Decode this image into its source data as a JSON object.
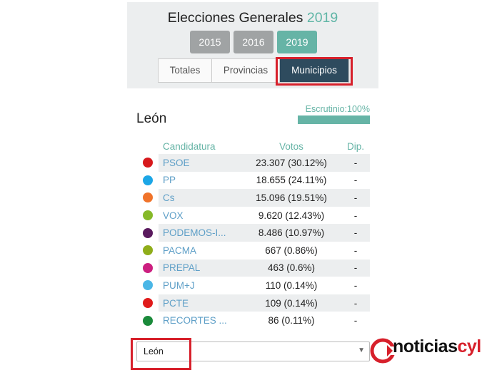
{
  "header": {
    "title_prefix": "Elecciones Generales",
    "title_year": "2019",
    "years": [
      {
        "label": "2015",
        "active": false
      },
      {
        "label": "2016",
        "active": false
      },
      {
        "label": "2019",
        "active": true
      }
    ],
    "tabs": [
      {
        "label": "Totales",
        "active": false
      },
      {
        "label": "Provincias",
        "active": false
      },
      {
        "label": "Municipios",
        "active": true
      }
    ]
  },
  "region": {
    "name": "León",
    "scrutiny_label": "Escrutinio:100%",
    "scrutiny_progress": 1.0
  },
  "table": {
    "headers": {
      "candidatura": "Candidatura",
      "votos": "Votos",
      "dip": "Dip."
    },
    "rows": [
      {
        "party": "PSOE",
        "votes": "23.307 (30.12%)",
        "dip": "-",
        "color": "#d7191c"
      },
      {
        "party": "PP",
        "votes": "18.655 (24.11%)",
        "dip": "-",
        "color": "#1ca6e6"
      },
      {
        "party": "Cs",
        "votes": "15.096 (19.51%)",
        "dip": "-",
        "color": "#f0732a"
      },
      {
        "party": "VOX",
        "votes": "9.620 (12.43%)",
        "dip": "-",
        "color": "#86b928"
      },
      {
        "party": "PODEMOS-I...",
        "votes": "8.486 (10.97%)",
        "dip": "-",
        "color": "#5a1a5e"
      },
      {
        "party": "PACMA",
        "votes": "667 (0.86%)",
        "dip": "-",
        "color": "#8fad1a"
      },
      {
        "party": "PREPAL",
        "votes": "463 (0.6%)",
        "dip": "-",
        "color": "#cc1f80"
      },
      {
        "party": "PUM+J",
        "votes": "110 (0.14%)",
        "dip": "-",
        "color": "#4ab6e6"
      },
      {
        "party": "PCTE",
        "votes": "109 (0.14%)",
        "dip": "-",
        "color": "#e01b1b"
      },
      {
        "party": "RECORTES ...",
        "votes": "86 (0.11%)",
        "dip": "-",
        "color": "#1a8a3a"
      }
    ]
  },
  "select": {
    "value": "León"
  },
  "logo": {
    "text_main": "noticias",
    "text_accent": "cyl"
  },
  "colors": {
    "accent": "#66b4a6",
    "active_tab": "#2e4b5e",
    "highlight_box": "#d7202b"
  }
}
